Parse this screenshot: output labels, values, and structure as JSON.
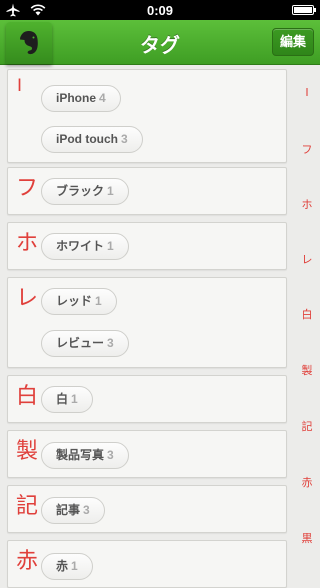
{
  "status": {
    "time": "0:09"
  },
  "nav": {
    "title": "タグ",
    "edit_label": "編集"
  },
  "sections": [
    {
      "letter": "I",
      "tags": [
        {
          "name": "iPhone",
          "count": "4"
        },
        {
          "name": "iPod touch",
          "count": "3"
        }
      ]
    },
    {
      "letter": "フ",
      "tags": [
        {
          "name": "ブラック",
          "count": "1"
        }
      ]
    },
    {
      "letter": "ホ",
      "tags": [
        {
          "name": "ホワイト",
          "count": "1"
        }
      ]
    },
    {
      "letter": "レ",
      "tags": [
        {
          "name": "レッド",
          "count": "1"
        },
        {
          "name": "レビュー",
          "count": "3"
        }
      ]
    },
    {
      "letter": "白",
      "tags": [
        {
          "name": "白",
          "count": "1"
        }
      ]
    },
    {
      "letter": "製",
      "tags": [
        {
          "name": "製品写真",
          "count": "3"
        }
      ]
    },
    {
      "letter": "記",
      "tags": [
        {
          "name": "記事",
          "count": "3"
        }
      ]
    },
    {
      "letter": "赤",
      "tags": [
        {
          "name": "赤",
          "count": "1"
        }
      ]
    }
  ],
  "index": [
    "I",
    "フ",
    "ホ",
    "レ",
    "白",
    "製",
    "記",
    "赤",
    "黒"
  ],
  "colors": {
    "accent_red": "#e0403b",
    "nav_green": "#4caf2d"
  }
}
